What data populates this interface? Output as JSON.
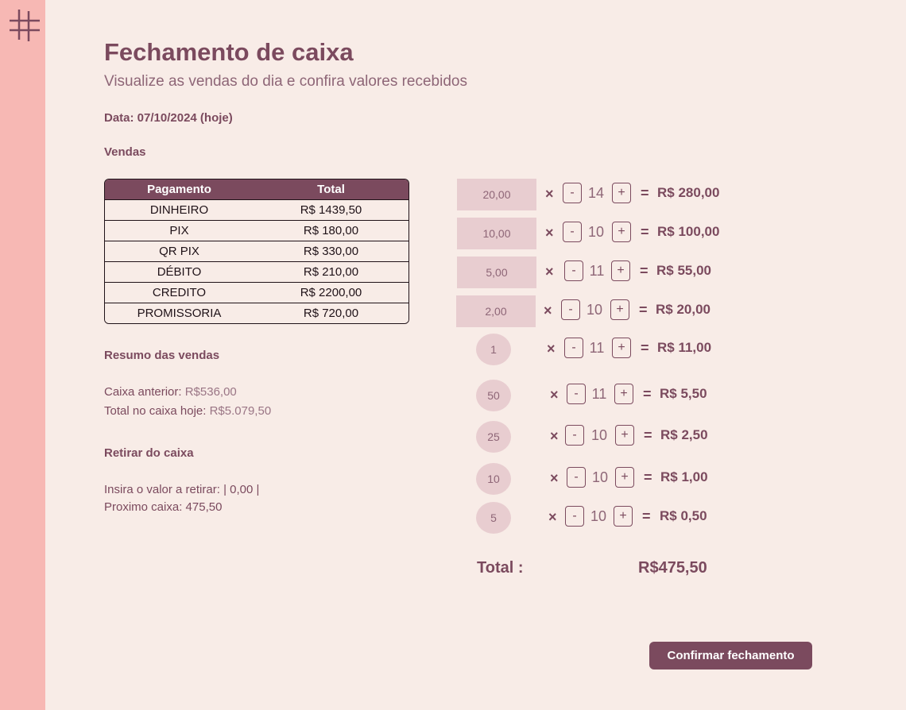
{
  "sidebar": {
    "logo_icon": "hash-grid-icon"
  },
  "header": {
    "title": "Fechamento de caixa",
    "subtitle": "Visualize as vendas do dia e confira valores recebidos"
  },
  "date_label": "Data: 07/10/2024 (hoje)",
  "sales": {
    "title": "Vendas",
    "columns": [
      "Pagamento",
      "Total"
    ],
    "rows": [
      [
        "DINHEIRO",
        "R$ 1439,50"
      ],
      [
        "PIX",
        "R$ 180,00"
      ],
      [
        "QR PIX",
        "R$ 330,00"
      ],
      [
        "DÉBITO",
        "R$ 210,00"
      ],
      [
        "CREDITO",
        "R$ 2200,00"
      ],
      [
        "PROMISSORIA",
        "R$ 720,00"
      ]
    ]
  },
  "summary": {
    "title": "Resumo das vendas",
    "previous_label": "Caixa anterior:",
    "previous_value": "R$536,00",
    "today_label": "Total no caixa hoje:",
    "today_value": "R$5.079,50"
  },
  "withdraw": {
    "title": "Retirar do caixa",
    "input_label": "Insira o valor a retirar:",
    "input_value": "| 0,00 |",
    "next_label": "Proximo caixa:",
    "next_value": "475,50"
  },
  "counter": {
    "times_symbol": "×",
    "minus_label": "-",
    "plus_label": "+",
    "equals_symbol": "=",
    "denominations": [
      {
        "label": "20,00",
        "kind": "note",
        "qty": "14",
        "subtotal": "R$ 280,00"
      },
      {
        "label": "10,00",
        "kind": "note",
        "qty": "10",
        "subtotal": "R$ 100,00"
      },
      {
        "label": "5,00",
        "kind": "note",
        "qty": "11",
        "subtotal": "R$ 55,00"
      },
      {
        "label": "2,00",
        "kind": "note",
        "qty": "10",
        "subtotal": "R$ 20,00"
      },
      {
        "label": "1",
        "kind": "coin",
        "qty": "11",
        "subtotal": "R$ 11,00"
      },
      {
        "label": "50",
        "kind": "coin",
        "qty": "11",
        "subtotal": "R$ 5,50"
      },
      {
        "label": "25",
        "kind": "coin",
        "qty": "10",
        "subtotal": "R$ 2,50"
      },
      {
        "label": "10",
        "kind": "coin",
        "qty": "10",
        "subtotal": "R$ 1,00"
      },
      {
        "label": "5",
        "kind": "coin",
        "qty": "10",
        "subtotal": "R$ 0,50"
      }
    ],
    "total_label": "Total :",
    "total_value": "R$475,50"
  },
  "confirm_label": "Confirmar fechamento"
}
